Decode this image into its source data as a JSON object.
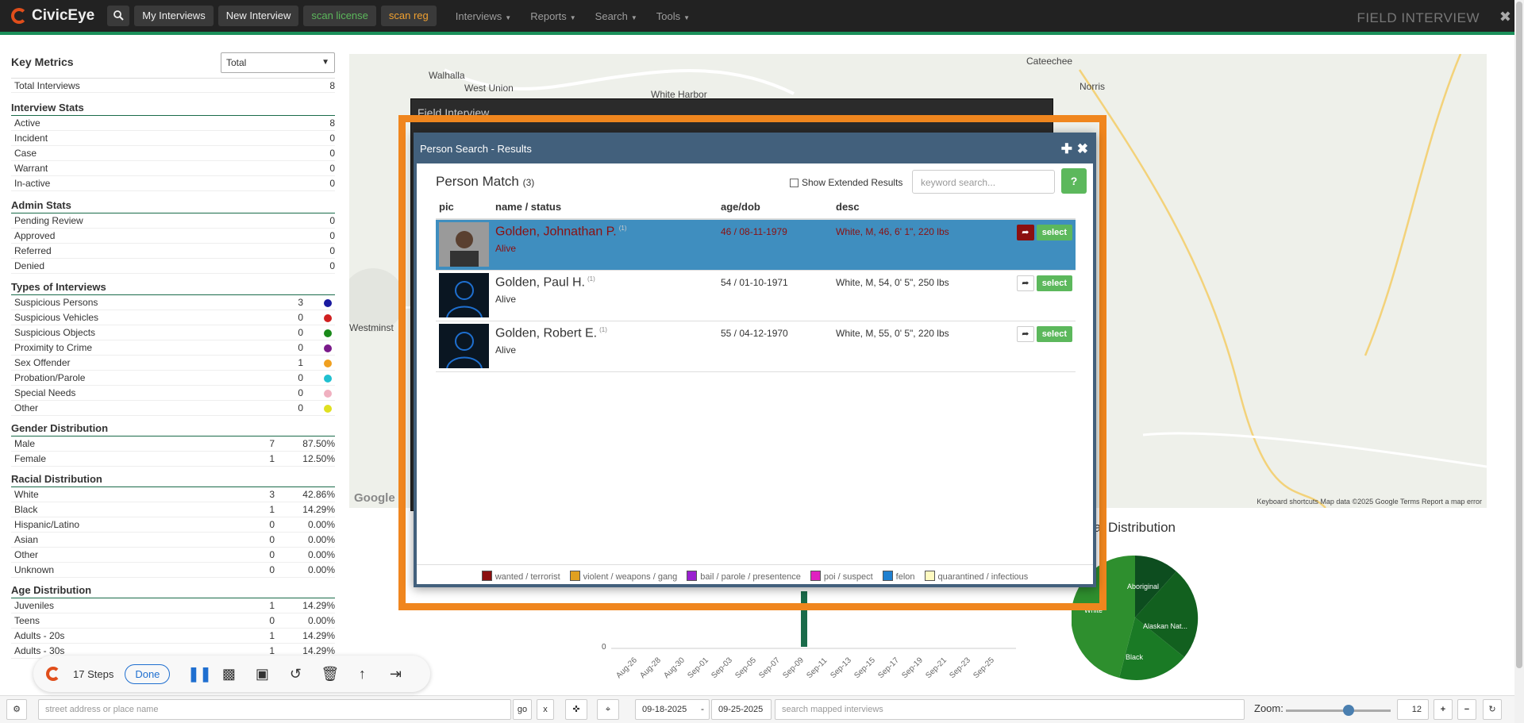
{
  "nav": {
    "brand": "CivicEye",
    "buttons": [
      "My Interviews",
      "New Interview"
    ],
    "scan_license": "scan license",
    "scan_reg": "scan reg",
    "menus": [
      "Interviews",
      "Reports",
      "Search",
      "Tools"
    ],
    "title": "FIELD INTERVIEW"
  },
  "metrics": {
    "title": "Key Metrics",
    "select_value": "Total",
    "total_label": "Total Interviews",
    "total_value": "8",
    "sections": [
      {
        "title": "Interview Stats",
        "rows": [
          [
            "Active",
            "8"
          ],
          [
            "Incident",
            "0"
          ],
          [
            "Case",
            "0"
          ],
          [
            "Warrant",
            "0"
          ],
          [
            "In-active",
            "0"
          ]
        ]
      },
      {
        "title": "Admin Stats",
        "rows": [
          [
            "Pending Review",
            "0"
          ],
          [
            "Approved",
            "0"
          ],
          [
            "Referred",
            "0"
          ],
          [
            "Denied",
            "0"
          ]
        ]
      }
    ],
    "types_title": "Types of Interviews",
    "types": [
      {
        "label": "Suspicious Persons",
        "count": "3",
        "color": "#1a1aa0"
      },
      {
        "label": "Suspicious Vehicles",
        "count": "0",
        "color": "#d02020"
      },
      {
        "label": "Suspicious Objects",
        "count": "0",
        "color": "#1a8a1a"
      },
      {
        "label": "Proximity to Crime",
        "count": "0",
        "color": "#7a1a8a"
      },
      {
        "label": "Sex Offender",
        "count": "1",
        "color": "#f0a020"
      },
      {
        "label": "Probation/Parole",
        "count": "0",
        "color": "#20c0d0"
      },
      {
        "label": "Special Needs",
        "count": "0",
        "color": "#f0b0c0"
      },
      {
        "label": "Other",
        "count": "0",
        "color": "#e0e020"
      }
    ],
    "gender_title": "Gender Distribution",
    "gender": [
      [
        "Male",
        "7",
        "87.50%"
      ],
      [
        "Female",
        "1",
        "12.50%"
      ]
    ],
    "race_title": "Racial Distribution",
    "race": [
      [
        "White",
        "3",
        "42.86%"
      ],
      [
        "Black",
        "1",
        "14.29%"
      ],
      [
        "Hispanic/Latino",
        "0",
        "0.00%"
      ],
      [
        "Asian",
        "0",
        "0.00%"
      ],
      [
        "Other",
        "0",
        "0.00%"
      ],
      [
        "Unknown",
        "0",
        "0.00%"
      ]
    ],
    "age_title": "Age Distribution",
    "age": [
      [
        "Juveniles",
        "1",
        "14.29%"
      ],
      [
        "Teens",
        "0",
        "0.00%"
      ],
      [
        "Adults - 20s",
        "1",
        "14.29%"
      ],
      [
        "Adults - 30s",
        "1",
        "14.29%"
      ]
    ]
  },
  "map": {
    "labels": [
      "Walhalla",
      "West Union",
      "White Harbor",
      "Cateechee",
      "Norris",
      "Westminst"
    ],
    "footer": "Keyboard shortcuts   Map data ©2025 Google   Terms   Report a map error",
    "google": "Google"
  },
  "background": {
    "field_interview_title": "Field Interview",
    "chart_title_fragment": "al Distribution",
    "axis_zero": "0",
    "x_ticks": [
      "Aug-26",
      "Aug-28",
      "Aug-30",
      "Sep-01",
      "Sep-03",
      "Sep-05",
      "Sep-07",
      "Sep-09",
      "Sep-11",
      "Sep-13",
      "Sep-15",
      "Sep-17",
      "Sep-19",
      "Sep-21",
      "Sep-23",
      "Sep-25"
    ],
    "pie_labels": [
      "Aboriginal",
      "Alaskan Nat...",
      "Black",
      "White"
    ]
  },
  "modal": {
    "title": "Person Search - Results",
    "heading": "Person Match",
    "count": "(3)",
    "extended_label": "Show Extended Results",
    "search_placeholder": "keyword search...",
    "help": "?",
    "columns": [
      "pic",
      "name / status",
      "age/dob",
      "desc"
    ],
    "rows": [
      {
        "name": "Golden, Johnathan P.",
        "sup": "(1)",
        "status": "Alive",
        "age": "46 / 08-11-1979",
        "desc": "White, M, 46, 6' 1\", 220 lbs",
        "select": "select"
      },
      {
        "name": "Golden, Paul H.",
        "sup": "(1)",
        "status": "Alive",
        "age": "54 / 01-10-1971",
        "desc": "White, M, 54, 0' 5\", 250 lbs",
        "select": "select"
      },
      {
        "name": "Golden, Robert E.",
        "sup": "(1)",
        "status": "Alive",
        "age": "55 / 04-12-1970",
        "desc": "White, M, 55, 0' 5\", 220 lbs",
        "select": "select"
      }
    ],
    "legend": [
      {
        "label": "wanted / terrorist",
        "color": "#8b1010"
      },
      {
        "label": "violent / weapons / gang",
        "color": "#e0a020"
      },
      {
        "label": "bail / parole / presentence",
        "color": "#9a20d0"
      },
      {
        "label": "poi / suspect",
        "color": "#e020c0"
      },
      {
        "label": "felon",
        "color": "#2080d0"
      },
      {
        "label": "quarantined / infectious",
        "color": "#fffac0"
      }
    ]
  },
  "bottom": {
    "address_placeholder": "street address or place name",
    "go": "go",
    "x": "x",
    "date_from": "09-18-2025",
    "dash": "-",
    "date_to": "09-25-2025",
    "search_placeholder": "search mapped interviews",
    "zoom_label": "Zoom:",
    "zoom_value": "12"
  },
  "recorder": {
    "steps": "17 Steps",
    "done": "Done"
  }
}
